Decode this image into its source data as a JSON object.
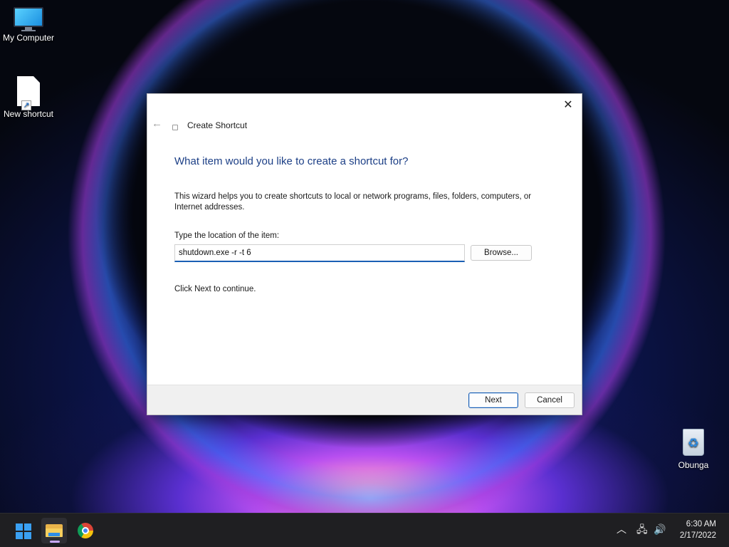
{
  "desktop": {
    "icons": [
      {
        "label": "My Computer",
        "icon": "computer-icon"
      },
      {
        "label": "New shortcut",
        "icon": "shortcut-file-icon"
      },
      {
        "label": "Obunga",
        "icon": "recycle-bin-icon"
      }
    ]
  },
  "dialog": {
    "title": "Create Shortcut",
    "heading": "What item would you like to create a shortcut for?",
    "description": "This wizard helps you to create shortcuts to local or network programs, files, folders, computers, or Internet addresses.",
    "location_label": "Type the location of the item:",
    "location_value": "shutdown.exe -r -t 6",
    "browse_label": "Browse...",
    "next_hint": "Click Next to continue.",
    "next_label": "Next",
    "cancel_label": "Cancel",
    "close_glyph": "✕",
    "back_glyph": "←"
  },
  "taskbar": {
    "apps": [
      {
        "name": "start",
        "icon": "windows-start-icon"
      },
      {
        "name": "file-explorer",
        "icon": "folder-icon",
        "active": true
      },
      {
        "name": "chrome",
        "icon": "chrome-icon"
      }
    ],
    "tray": {
      "chevron_glyph": "︿",
      "network_glyph": "🖧",
      "volume_glyph": "🔊"
    },
    "time": "6:30 AM",
    "date": "2/17/2022"
  },
  "colors": {
    "accent": "#1a5fb4",
    "heading": "#1c3f86",
    "taskbar": "#1f1f22"
  }
}
